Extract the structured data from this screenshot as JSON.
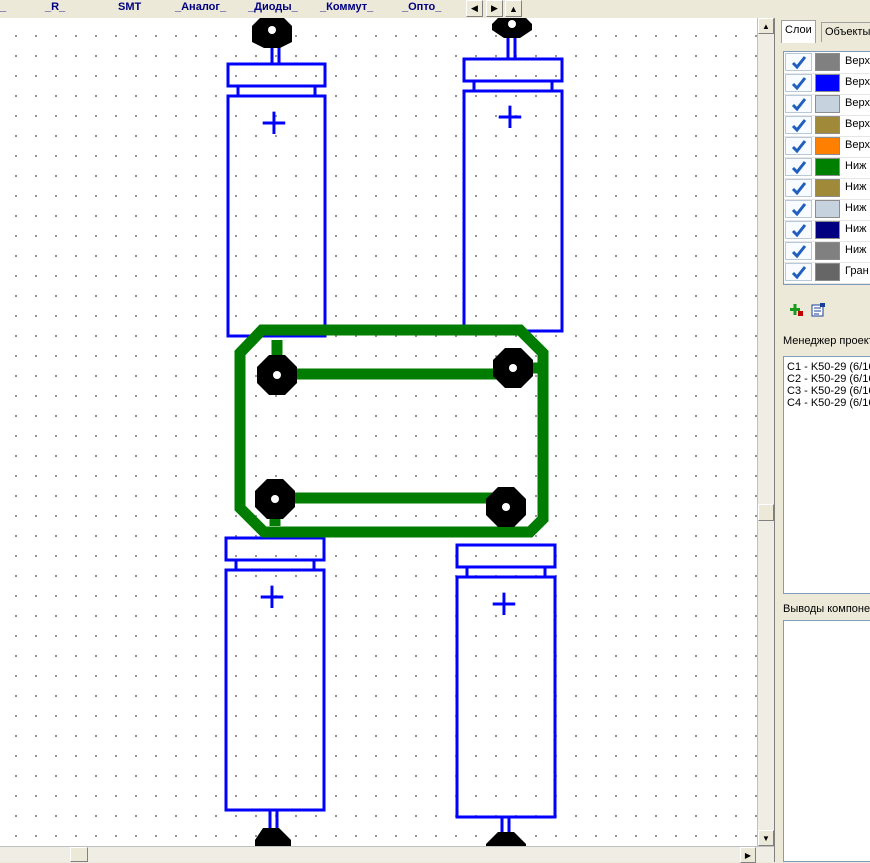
{
  "library_tabs": [
    "_R_",
    "SMT",
    "_Аналог_",
    "_Диоды_",
    "_Коммут_",
    "_Опто_"
  ],
  "panel": {
    "tabs": [
      "Слои",
      "Объекты"
    ],
    "layers": [
      {
        "name": "Верх",
        "color": "#808080"
      },
      {
        "name": "Верх",
        "color": "#0000ff"
      },
      {
        "name": "Верх",
        "color": "#c6d3df"
      },
      {
        "name": "Верх",
        "color": "#a08a3a"
      },
      {
        "name": "Верх",
        "color": "#ff8000"
      },
      {
        "name": "Ниж",
        "color": "#008000"
      },
      {
        "name": "Ниж",
        "color": "#a08a3a"
      },
      {
        "name": "Ниж",
        "color": "#c6d3df"
      },
      {
        "name": "Ниж",
        "color": "#000080"
      },
      {
        "name": "Ниж",
        "color": "#808080"
      },
      {
        "name": "Гран",
        "color": "#666666"
      }
    ],
    "project_manager_label": "Менеджер проекта",
    "components": [
      "C1 - K50-29 (6/16",
      "C2 - K50-29 (6/16",
      "C3 - K50-29 (6/16",
      "C4 - K50-29 (6/16"
    ],
    "pins_label": "Выводы компонента"
  },
  "board": {
    "silkscreen_color": "#0000ff",
    "copper_color": "#007d00",
    "pad_color": "#000000",
    "capacitor_polarity": [
      "+",
      "+",
      "+",
      "+"
    ]
  }
}
